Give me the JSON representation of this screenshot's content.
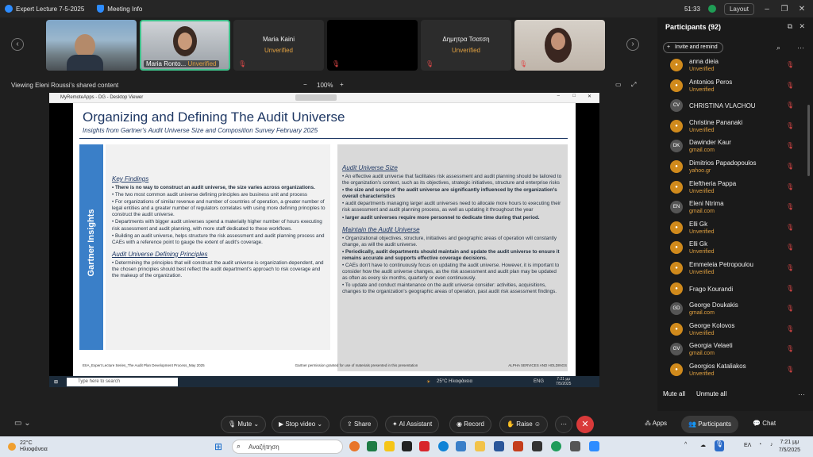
{
  "titlebar": {
    "app_title": "Expert Lecture 7-5-2025",
    "meeting_info": "Meeting Info",
    "time": "51:33",
    "layout": "Layout"
  },
  "tiles": [
    {
      "name": "",
      "status": ""
    },
    {
      "name": "Maria Ronto...",
      "status": "Unverified"
    },
    {
      "name": "Maria Kaini",
      "status": "Unverified"
    },
    {
      "name": "",
      "status": ""
    },
    {
      "name": "Δημητρα Τσατση",
      "status": "Unverified"
    },
    {
      "name": "",
      "status": ""
    }
  ],
  "sharebar": {
    "label": "Viewing Eleni Roussi's shared content",
    "zoom": "100%"
  },
  "window": {
    "title": "MyRemoteApps - DG - Desktop Viewer"
  },
  "slide": {
    "title": "Organizing and Defining The Audit Universe",
    "subtitle": "Insights from Gartner's Audit Universe Size and Composition Survey February 2025",
    "sidebar_label": "Gartner Insights",
    "key_findings_title": "Key Findings",
    "key_findings": [
      "• There is no way to construct an audit universe, the size varies across organizations.",
      "• The two most common audit universe defining principles are business unit and process",
      "• For organizations of similar revenue and number of countries of operation, a greater number of legal entities and a greater number of regulators correlates with using more defining principles to construct the audit universe.",
      "• Departments with bigger audit universes spend a materially higher number of hours executing risk assessment and audit planning, with more staff dedicated to these workflows.",
      "• Building an audit universe, helps structure the risk assessment and audit planning process and CAEs with a reference point to gauge the extent of audit's coverage."
    ],
    "defining_title": "Audit Universe Defining Principles",
    "defining": [
      "• Determining the principles that will construct the audit universe is organization-dependent, and the chosen principles should best reflect the audit department's approach to risk coverage and the makeup of the organization."
    ],
    "size_title": "Audit Universe Size",
    "size": [
      "• An effective audit universe that facilitates risk assessment and audit planning should be tailored to the organization's context, such as its objectives, strategic initiatives, structure and enterprise risks",
      "• the size and scope of the audit universe are significantly influenced by the organization's overall characteristics",
      "• audit departments managing larger audit universes need to allocate more hours to executing their risk assessment and audit planning process, as well as updating it throughout the year",
      "• larger audit universes require more personnel to dedicate time during that period."
    ],
    "maintain_title": "Maintain the Audit Universe",
    "maintain": [
      "• Organizational objectives, structure, initiatives and geographic areas of operation will constantly change, as will the audit universe.",
      "• Periodically, audit departments should maintain and update the audit universe to ensure it remains accurate and supports effective coverage decisions.",
      "• CAEs don't have to continuously focus on updating the audit universe. However, it is important to consider how the audit universe changes, as the risk assessment and audit plan may be updated as often as every six months, quarterly or even continuously.",
      "• To update and conduct maintenance on the audit universe consider: activities, acquisitions, changes to the organization's geographic areas of operation, past audit risk assessment findings."
    ],
    "footer_left": "EIIA_Expert Lecture Series_The Audit Plan Development Process_May 2025",
    "footer_mid": "Gartner permission granted for use of materials presented in this presentation",
    "footer_right": "ALPHA SERVICES AND HOLDINGS"
  },
  "inner_taskbar": {
    "search": "Type here to search",
    "weather": "25°C Ηλιοφάνεια",
    "lang": "ENG",
    "time": "7:21 μμ",
    "date": "7/5/2025"
  },
  "panel": {
    "title": "Participants (92)",
    "invite": "Invite and remind",
    "participants": [
      {
        "name": "anna dieia",
        "sub": "Unverified",
        "init": ""
      },
      {
        "name": "Antonios Peros",
        "sub": "Unverified",
        "init": ""
      },
      {
        "name": "CHRISTINA VLACHOU",
        "sub": "",
        "init": "CV"
      },
      {
        "name": "Christine Pananaki",
        "sub": "Unverified",
        "init": ""
      },
      {
        "name": "Dawinder Kaur",
        "sub": "gmail.com",
        "init": "DK"
      },
      {
        "name": "Dimitrios Papadopoulos",
        "sub": "yahoo.gr",
        "init": ""
      },
      {
        "name": "Eleftheria Pappa",
        "sub": "Unverified",
        "init": ""
      },
      {
        "name": "Eleni Ntrima",
        "sub": "gmail.com",
        "init": "EN"
      },
      {
        "name": "Elli Gk",
        "sub": "Unverified",
        "init": ""
      },
      {
        "name": "Elli Gk",
        "sub": "Unverified",
        "init": ""
      },
      {
        "name": "Emmeleia Petropoulou",
        "sub": "Unverified",
        "init": ""
      },
      {
        "name": "Frago Kourandi",
        "sub": "",
        "init": ""
      },
      {
        "name": "George Doukakis",
        "sub": "gmail.com",
        "init": "GD"
      },
      {
        "name": "George Kolovos",
        "sub": "Unverified",
        "init": ""
      },
      {
        "name": "Georgia Velaeti",
        "sub": "gmail.com",
        "init": "GV"
      },
      {
        "name": "Georgios Kataliakos",
        "sub": "Unverified",
        "init": ""
      }
    ],
    "mute_all": "Mute all",
    "unmute_all": "Unmute all"
  },
  "toolbar": {
    "mute": "Mute",
    "stop_video": "Stop video",
    "share": "Share",
    "ai": "AI Assistant",
    "record": "Record",
    "raise": "Raise",
    "apps": "Apps",
    "participants": "Participants",
    "chat": "Chat"
  },
  "taskbar": {
    "temp": "22°C",
    "weather": "Ηλιοφάνεια",
    "search": "Αναζήτηση",
    "lang": "ΕΛ",
    "time": "7:21 μμ",
    "date": "7/5/2025"
  }
}
